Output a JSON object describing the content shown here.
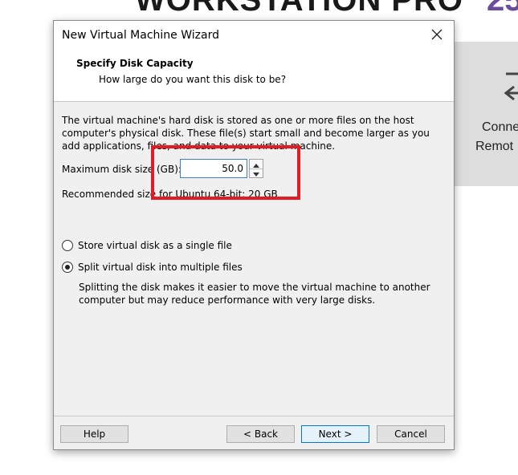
{
  "background_app": {
    "title": "WORKSTATION PRO",
    "version": "25",
    "tile": {
      "icon": "connect-remote-icon",
      "line1": "Conne",
      "line2": "Remot"
    }
  },
  "dialog": {
    "title": "New Virtual Machine Wizard",
    "header": {
      "title": "Specify Disk Capacity",
      "subtitle": "How large do you want this disk to be?"
    },
    "description": "The virtual machine's hard disk is stored as one or more files on the host computer's physical disk. These file(s) start small and become larger as you add applications, files, and data to your virtual machine.",
    "max_size_label": "Maximum disk size (GB):",
    "max_size_value": "50.0",
    "recommended": "Recommended size for Ubuntu 64-bit: 20 GB",
    "options": [
      {
        "label": "Store virtual disk as a single file",
        "selected": false
      },
      {
        "label": "Split virtual disk into multiple files",
        "selected": true
      }
    ],
    "split_help": "Splitting the disk makes it easier to move the virtual machine to another computer but may reduce performance with very large disks.",
    "buttons": {
      "help": "Help",
      "back": "< Back",
      "next": "Next >",
      "cancel": "Cancel"
    }
  },
  "colors": {
    "highlight": "#e31b23",
    "input_focus": "#3b7fd1",
    "version_accent": "#6a4b9c"
  }
}
